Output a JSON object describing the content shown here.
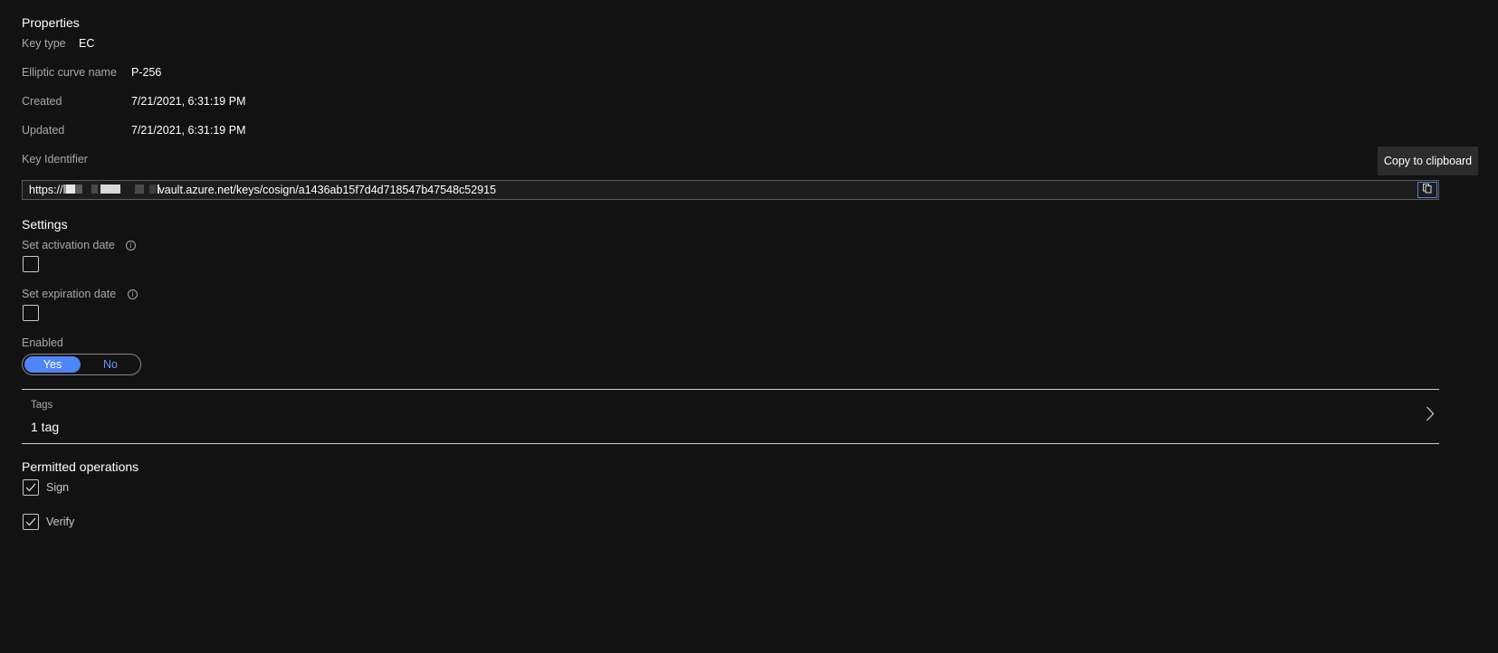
{
  "properties": {
    "title": "Properties",
    "key_type_label": "Key type",
    "key_type_value": "EC",
    "curve_label": "Elliptic curve name",
    "curve_value": "P-256",
    "created_label": "Created",
    "created_value": "7/21/2021, 6:31:19 PM",
    "updated_label": "Updated",
    "updated_value": "7/21/2021, 6:31:19 PM",
    "key_id_label": "Key Identifier",
    "key_id_prefix": "https://",
    "key_id_suffix": "vault.azure.net/keys/cosign/a1436ab15f7d4d718547b47548c52915",
    "copy_tooltip": "Copy to clipboard",
    "copy_icon": "copy-icon"
  },
  "settings": {
    "title": "Settings",
    "activation_label": "Set activation date",
    "activation_checked": false,
    "expiration_label": "Set expiration date",
    "expiration_checked": false,
    "info_icon": "info-icon",
    "enabled_label": "Enabled",
    "enabled_yes": "Yes",
    "enabled_no": "No",
    "enabled_selected": "Yes"
  },
  "tags": {
    "label": "Tags",
    "value": "1 tag",
    "chevron_icon": "chevron-right-icon"
  },
  "permitted_operations": {
    "title": "Permitted operations",
    "items": [
      {
        "label": "Sign",
        "checked": true
      },
      {
        "label": "Verify",
        "checked": true
      }
    ]
  },
  "colors": {
    "background": "#121212",
    "accent": "#4f86f7",
    "accent_text": "#5b9cff",
    "label_text": "#a8a8a8"
  }
}
